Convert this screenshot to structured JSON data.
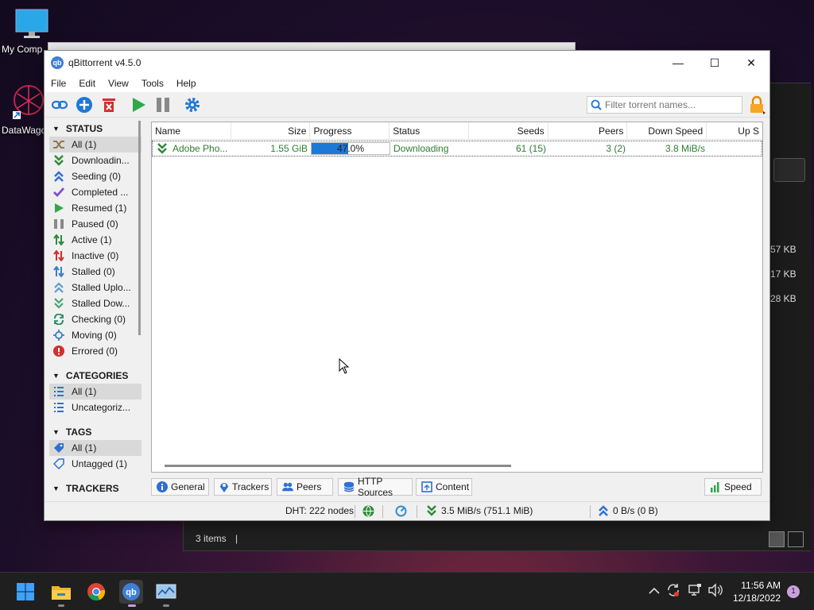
{
  "desktop": {
    "icons": [
      {
        "label": "My Comp",
        "icon": "computer-icon"
      },
      {
        "label": "DataWago",
        "icon": "datawago-icon"
      }
    ]
  },
  "background_window": {
    "sizes": [
      "57 KB",
      "17 KB",
      "28 KB"
    ],
    "status": "3 items"
  },
  "window": {
    "title": "qBittorrent v4.5.0",
    "menu": [
      "File",
      "Edit",
      "View",
      "Tools",
      "Help"
    ],
    "filter_placeholder": "Filter torrent names..."
  },
  "sidebar": {
    "status_header": "STATUS",
    "status_items": [
      {
        "label": "All (1)",
        "icon": "all-icon"
      },
      {
        "label": "Downloadin...",
        "icon": "downloading-icon"
      },
      {
        "label": "Seeding (0)",
        "icon": "seeding-icon"
      },
      {
        "label": "Completed ...",
        "icon": "completed-icon"
      },
      {
        "label": "Resumed (1)",
        "icon": "resumed-icon"
      },
      {
        "label": "Paused (0)",
        "icon": "paused-icon"
      },
      {
        "label": "Active (1)",
        "icon": "active-icon"
      },
      {
        "label": "Inactive (0)",
        "icon": "inactive-icon"
      },
      {
        "label": "Stalled (0)",
        "icon": "stalled-icon"
      },
      {
        "label": "Stalled Uplo...",
        "icon": "stalled-upload-icon"
      },
      {
        "label": "Stalled Dow...",
        "icon": "stalled-download-icon"
      },
      {
        "label": "Checking (0)",
        "icon": "checking-icon"
      },
      {
        "label": "Moving (0)",
        "icon": "moving-icon"
      },
      {
        "label": "Errored (0)",
        "icon": "errored-icon"
      }
    ],
    "categories_header": "CATEGORIES",
    "category_items": [
      {
        "label": "All (1)"
      },
      {
        "label": "Uncategoriz..."
      }
    ],
    "tags_header": "TAGS",
    "tag_items": [
      {
        "label": "All (1)"
      },
      {
        "label": "Untagged (1)"
      }
    ],
    "trackers_header": "TRACKERS"
  },
  "table": {
    "columns": [
      "Name",
      "Size",
      "Progress",
      "Status",
      "Seeds",
      "Peers",
      "Down Speed",
      "Up S"
    ],
    "rows": [
      {
        "name": "Adobe Pho...",
        "size": "1.55 GiB",
        "progress_text": "47.0%",
        "progress": 0.47,
        "status": "Downloading",
        "seeds": "61 (15)",
        "peers": "3 (2)",
        "down_speed": "3.8 MiB/s"
      }
    ]
  },
  "tabs": {
    "general": "General",
    "trackers": "Trackers",
    "peers": "Peers",
    "http_sources": "HTTP Sources",
    "content": "Content",
    "speed": "Speed"
  },
  "statusbar": {
    "dht": "DHT: 222 nodes",
    "download": "3.5 MiB/s (751.1 MiB)",
    "upload": "0 B/s (0 B)"
  },
  "taskbar": {
    "time": "11:56 AM",
    "date": "12/18/2022",
    "notifications": "1"
  },
  "colors": {
    "accent": "#1e78d6",
    "downloading_text": "#2e7d32"
  }
}
